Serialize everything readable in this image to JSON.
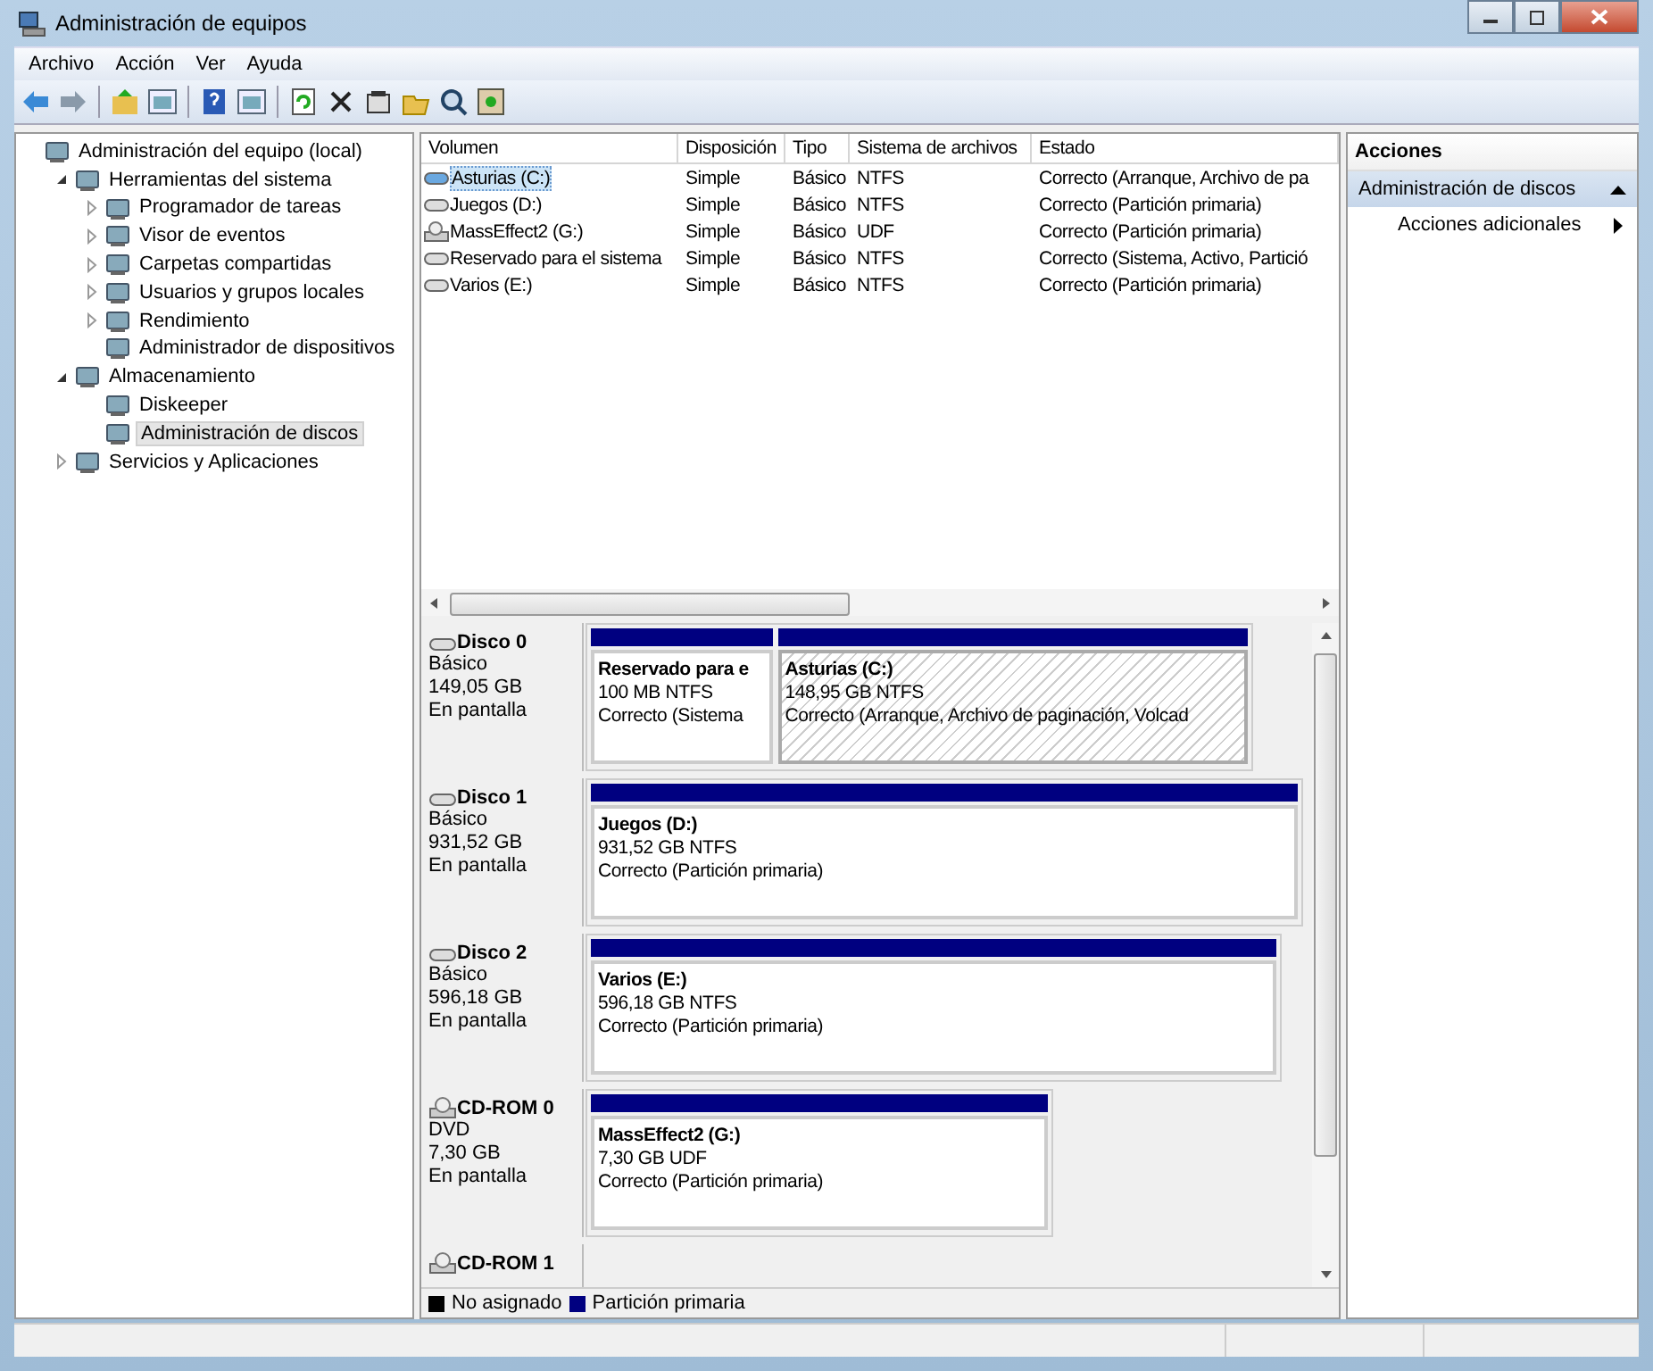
{
  "window": {
    "title": "Administración de equipos"
  },
  "menu": [
    {
      "label": "Archivo"
    },
    {
      "label": "Acción"
    },
    {
      "label": "Ver"
    },
    {
      "label": "Ayuda"
    }
  ],
  "tree": [
    {
      "label": "Administración del equipo (local)",
      "selected": false,
      "children": [
        {
          "label": "Herramientas del sistema",
          "expanded": true,
          "selected": false,
          "children": [
            {
              "label": "Programador de tareas",
              "expanded": false,
              "selected": false
            },
            {
              "label": "Visor de eventos",
              "expanded": false,
              "selected": false
            },
            {
              "label": "Carpetas compartidas",
              "expanded": false,
              "selected": false
            },
            {
              "label": "Usuarios y grupos locales",
              "expanded": false,
              "selected": false
            },
            {
              "label": "Rendimiento",
              "expanded": false,
              "selected": false
            },
            {
              "label": "Administrador de dispositivos",
              "selected": false
            }
          ]
        },
        {
          "label": "Almacenamiento",
          "expanded": true,
          "selected": false,
          "children": [
            {
              "label": "Diskeeper",
              "selected": false
            },
            {
              "label": "Administración de discos",
              "selected": true
            }
          ]
        },
        {
          "label": "Servicios y Aplicaciones",
          "expanded": false,
          "selected": false
        }
      ]
    }
  ],
  "volumes": {
    "columns": [
      "Volumen",
      "Disposición",
      "Tipo",
      "Sistema de archivos",
      "Estado"
    ],
    "rows": [
      {
        "kind": "drive",
        "cells": [
          "Asturias (C:)",
          "Simple",
          "Básico",
          "NTFS",
          "Correcto (Arranque, Archivo de pa"
        ],
        "selected": true
      },
      {
        "kind": "drive",
        "cells": [
          "Juegos (D:)",
          "Simple",
          "Básico",
          "NTFS",
          "Correcto (Partición primaria)"
        ],
        "selected": false
      },
      {
        "kind": "cd",
        "cells": [
          "MassEffect2 (G:)",
          "Simple",
          "Básico",
          "UDF",
          "Correcto (Partición primaria)"
        ],
        "selected": false
      },
      {
        "kind": "drive",
        "cells": [
          "Reservado para el sistema",
          "Simple",
          "Básico",
          "NTFS",
          "Correcto (Sistema, Activo, Partició"
        ],
        "selected": false
      },
      {
        "kind": "drive",
        "cells": [
          "Varios (E:)",
          "Simple",
          "Básico",
          "NTFS",
          "Correcto (Partición primaria)"
        ],
        "selected": false
      }
    ]
  },
  "disks": [
    {
      "kind": "disk",
      "name": "Disco 0",
      "lines": [
        "Básico",
        "149,05 GB",
        "En pantalla"
      ],
      "partitions": [
        {
          "name": "Reservado para e",
          "size": "100 MB NTFS",
          "status": "Correcto (Sistema",
          "selected": false
        },
        {
          "name": "Asturias  (C:)",
          "size": "148,95 GB NTFS",
          "status": "Correcto (Arranque, Archivo de paginación, Volcad",
          "selected": true
        }
      ]
    },
    {
      "kind": "disk",
      "name": "Disco 1",
      "lines": [
        "Básico",
        "931,52 GB",
        "En pantalla"
      ],
      "partitions": [
        {
          "name": "Juegos  (D:)",
          "size": "931,52 GB NTFS",
          "status": "Correcto (Partición primaria)",
          "selected": false
        }
      ]
    },
    {
      "kind": "disk",
      "name": "Disco 2",
      "lines": [
        "Básico",
        "596,18 GB",
        "En pantalla"
      ],
      "partitions": [
        {
          "name": "Varios  (E:)",
          "size": "596,18 GB NTFS",
          "status": "Correcto (Partición primaria)",
          "selected": false
        }
      ]
    },
    {
      "kind": "cd",
      "name": "CD-ROM 0",
      "lines": [
        "DVD",
        "7,30 GB",
        "En pantalla"
      ],
      "partitions": [
        {
          "name": "MassEffect2  (G:)",
          "size": "7,30 GB UDF",
          "status": "Correcto (Partición primaria)",
          "selected": false
        }
      ]
    },
    {
      "kind": "cd",
      "name": "CD-ROM 1"
    }
  ],
  "legend": [
    {
      "label": "No asignado",
      "color": "#000000"
    },
    {
      "label": "Partición primaria",
      "color": "#000080"
    }
  ],
  "actions": {
    "title": "Acciones",
    "section": {
      "label": "Administración de discos",
      "expanded": true
    },
    "items": [
      {
        "label": "Acciones adicionales"
      }
    ]
  }
}
